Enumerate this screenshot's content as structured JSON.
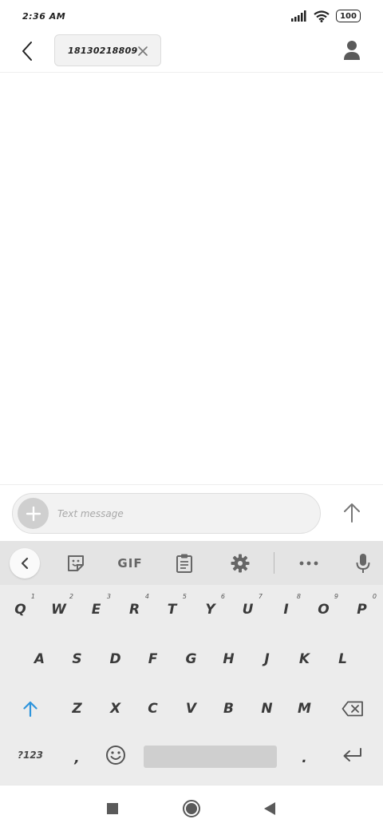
{
  "status_bar": {
    "time": "2:36 AM",
    "battery": "100",
    "icons": [
      "signal-icon",
      "wifi-icon",
      "battery-icon"
    ]
  },
  "header": {
    "recipient": "18130218809",
    "icons": [
      "back-arrow-icon",
      "close-icon",
      "contact-icon"
    ]
  },
  "compose": {
    "placeholder": "Text message",
    "icons": [
      "plus-icon",
      "send-arrow-icon"
    ]
  },
  "keyboard": {
    "toolbar": {
      "gif_label": "GIF",
      "icons": [
        "chevron-left-icon",
        "sticker-icon",
        "clipboard-icon",
        "gear-icon",
        "more-icon",
        "mic-icon"
      ]
    },
    "row1": [
      {
        "label": "Q",
        "hint": "1"
      },
      {
        "label": "W",
        "hint": "2"
      },
      {
        "label": "E",
        "hint": "3"
      },
      {
        "label": "R",
        "hint": "4"
      },
      {
        "label": "T",
        "hint": "5"
      },
      {
        "label": "Y",
        "hint": "6"
      },
      {
        "label": "U",
        "hint": "7"
      },
      {
        "label": "I",
        "hint": "8"
      },
      {
        "label": "O",
        "hint": "9"
      },
      {
        "label": "P",
        "hint": "0"
      }
    ],
    "row2": [
      "A",
      "S",
      "D",
      "F",
      "G",
      "H",
      "J",
      "K",
      "L"
    ],
    "row3": [
      "Z",
      "X",
      "C",
      "V",
      "B",
      "N",
      "M"
    ],
    "row4": {
      "symbols": "?123",
      "comma": ",",
      "period": "."
    },
    "accent_color": "#2f95dc"
  },
  "nav_bar": {
    "icons": [
      "recents-square-icon",
      "home-circle-icon",
      "back-triangle-icon"
    ]
  }
}
